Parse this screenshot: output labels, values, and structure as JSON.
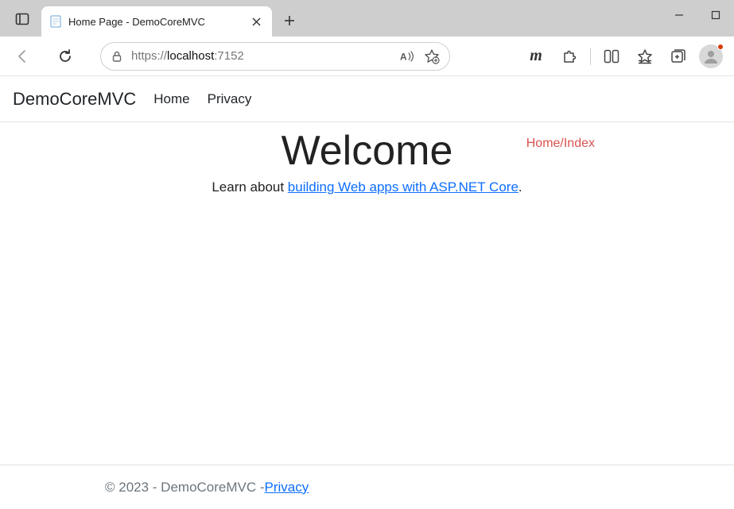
{
  "browser": {
    "tab_title": "Home Page - DemoCoreMVC",
    "url": {
      "protocol": "https://",
      "host": "localhost",
      "port": ":7152"
    }
  },
  "nav": {
    "brand": "DemoCoreMVC",
    "links": [
      "Home",
      "Privacy"
    ]
  },
  "annotation": "Home/Index",
  "hero": {
    "title": "Welcome",
    "lead_prefix": "Learn about ",
    "lead_link": "building Web apps with ASP.NET Core",
    "lead_suffix": "."
  },
  "footer": {
    "text": "© 2023 - DemoCoreMVC - ",
    "link": "Privacy"
  }
}
